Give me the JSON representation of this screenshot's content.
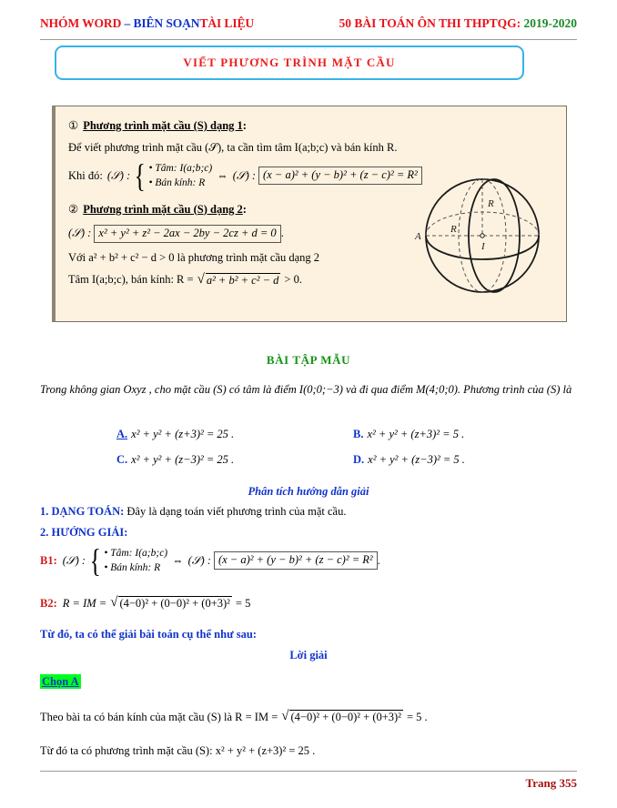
{
  "header": {
    "left_part1": "NHÓM WORD",
    "left_dash": " – ",
    "left_part2": "BIÊN SOẠN",
    "left_part3": "TÀI LIỆU",
    "right_label": "50 BÀI TOÁN ÔN THI THPTQG:",
    "right_year": "2019-2020"
  },
  "title": {
    "text": "VIẾT PHƯƠNG TRÌNH MẶT CẦU"
  },
  "theory": {
    "item1_num": "①",
    "item1_head": "Phương trình mặt cầu (S) dạng 1",
    "item1_colon": ":",
    "item1_intro": "Để viết phương trình mặt cầu (𝒮), ta cần tìm tâm I(a;b;c) và bán kính R.",
    "khido_label": "Khi đó:",
    "khido_s": "(𝒮) :",
    "sys_row1": "• Tâm: I(a;b;c)",
    "sys_row2": "• Bán kính: R",
    "equiv": "⇔",
    "s_label": "(𝒮) :",
    "eq1": "(x − a)² + (y − b)² + (z − c)² = R²",
    "item2_num": "②",
    "item2_head": "Phương trình mặt cầu (S) dạng 2",
    "item2_colon": ":",
    "eq2_prefix": "(𝒮) :",
    "eq2": "x² + y² + z² − 2ax − 2by − 2cz + d = 0",
    "eq2_suffix": ".",
    "cond_line": "Với a² + b² + c² − d > 0 là phương trình mặt cầu dạng 2",
    "center_line_prefix": "Tâm I(a;b;c), bán kính:  R =",
    "center_line_radicand": "a² + b² + c² − d",
    "center_line_suffix": "> 0."
  },
  "figure": {
    "label_A": "A",
    "label_R_horizontal": "R",
    "label_R_vertical": "R",
    "label_I": "I"
  },
  "exercise": {
    "heading": "BÀI TẬP MẪU",
    "statement": "Trong không gian Oxyz , cho mặt cầu (S) có tâm là điểm I(0;0;−3) và đi qua điểm M(4;0;0). Phương trình của (S) là",
    "options": [
      {
        "key": "A.",
        "text": "x² + y² + (z+3)² = 25 .",
        "correct": true
      },
      {
        "key": "B.",
        "text": "x² + y² + (z+3)² = 5 .",
        "correct": false
      },
      {
        "key": "C.",
        "text": "x² + y² + (z−3)² = 25 .",
        "correct": false
      },
      {
        "key": "D.",
        "text": "x² + y² + (z−3)² = 5 .",
        "correct": false
      }
    ]
  },
  "analysis": {
    "heading": "Phân tích hướng dẫn giải",
    "dang_toan_label": "1. DẠNG TOÁN:",
    "dang_toan_text": " Đây là dạng toán viết phương trình của mặt cầu.",
    "huong_giai_label": "2. HƯỚNG GIẢI:",
    "b1_label": "B1:",
    "b1_s": "(𝒮) :",
    "b1_sys_row1": "• Tâm: I(a;b;c)",
    "b1_sys_row2": "• Bán kính: R",
    "b1_equiv": "⇔",
    "b1_s2": "(𝒮) :",
    "b1_eq": "(x − a)² + (y − b)² + (z − c)² = R²",
    "b1_suffix": ".",
    "b2_label": "B2:",
    "b2_prefix": "R = IM =",
    "b2_radicand": "(4−0)² + (0−0)² + (0+3)²",
    "b2_suffix": "= 5",
    "tu_do": "Từ đó, ta có thể giải bài toán cụ thể như sau:",
    "loi_giai": "Lời giải",
    "chon": "Chọn A",
    "final1_prefix": "Theo bài ta có bán kính của mặt cầu (S) là  R = IM =",
    "final1_radicand": "(4−0)² + (0−0)² + (0+3)²",
    "final1_suffix": "= 5 .",
    "final2": "Từ đó ta có phương trình mặt cầu (S): x² + y² + (z+3)² = 25 ."
  },
  "footer": {
    "page": "Trang 355"
  }
}
